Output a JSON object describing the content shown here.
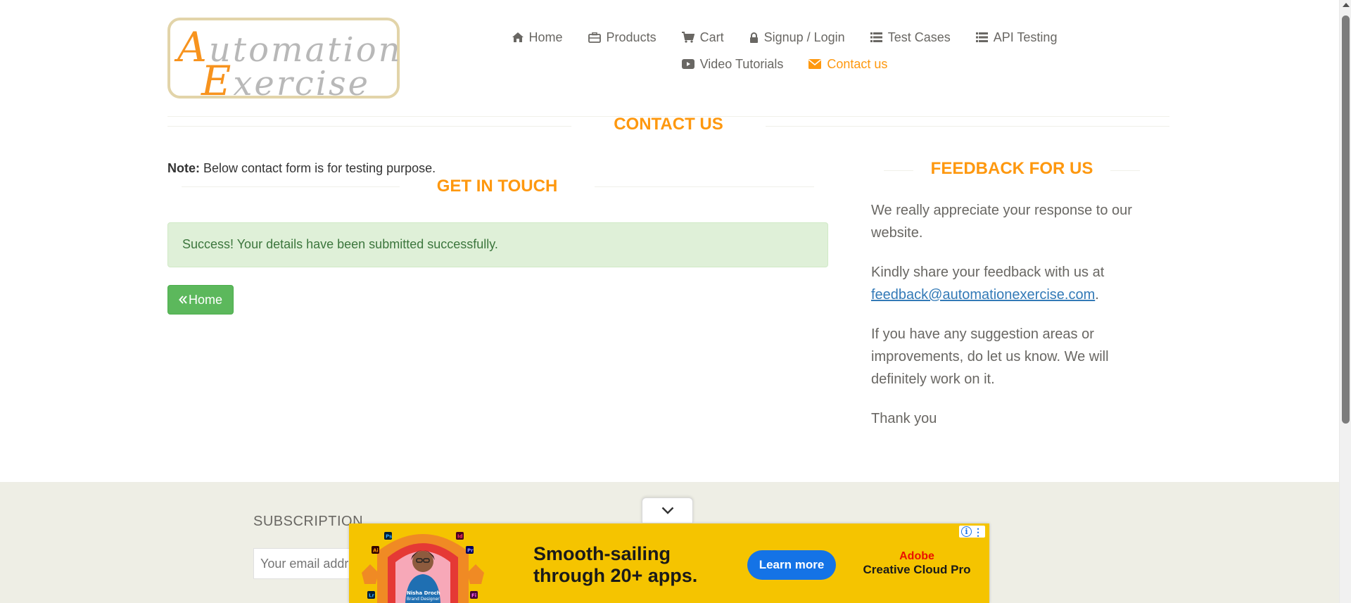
{
  "logo": {
    "line1_cap": "A",
    "line1_rest": "utomation",
    "line2_cap": "E",
    "line2_rest": "xercise"
  },
  "nav": {
    "items": [
      {
        "label": "Home",
        "icon": "home-icon"
      },
      {
        "label": "Products",
        "icon": "briefcase-icon"
      },
      {
        "label": "Cart",
        "icon": "cart-icon"
      },
      {
        "label": "Signup / Login",
        "icon": "lock-icon"
      },
      {
        "label": "Test Cases",
        "icon": "list-icon"
      },
      {
        "label": "API Testing",
        "icon": "list-icon"
      },
      {
        "label": "Video Tutorials",
        "icon": "youtube-icon"
      },
      {
        "label": "Contact us",
        "icon": "envelope-icon",
        "active": true
      }
    ]
  },
  "page": {
    "title": "CONTACT US",
    "note_label": "Note:",
    "note_text": " Below contact form is for testing purpose.",
    "get_in_touch": "GET IN TOUCH",
    "success_message": "Success! Your details have been submitted successfully.",
    "home_button": "Home"
  },
  "feedback": {
    "title": "FEEDBACK FOR US",
    "p1": "We really appreciate your response to our website.",
    "p2_text": "Kindly share your feedback with us at ",
    "p2_email": "feedback@automationexercise.com",
    "p2_end": ".",
    "p3": "If you have any suggestion areas or improvements, do let us know. We will definitely work on it.",
    "p4": "Thank you"
  },
  "footer": {
    "subscription_title": "SUBSCRIPTION",
    "email_placeholder": "Your email address"
  },
  "ad": {
    "headline_line1": "Smooth-sailing",
    "headline_line2": "through 20+ apps.",
    "cta": "Learn more",
    "brand_line1": "Adobe",
    "brand_line2": "Creative Cloud Pro",
    "person_name": "Nisha Droch",
    "person_title": "Brand Designer",
    "app_badges": [
      "Ps",
      "Id",
      "Ai",
      "Pr",
      "Lr",
      "Fi"
    ]
  },
  "colors": {
    "accent": "#fe980f",
    "success_bg": "#dff0d8",
    "success_text": "#3c763d",
    "button_green": "#5cb85c",
    "footer_bg": "#eeeee5",
    "ad_yellow": "#f5c400",
    "link": "#337ab7"
  }
}
